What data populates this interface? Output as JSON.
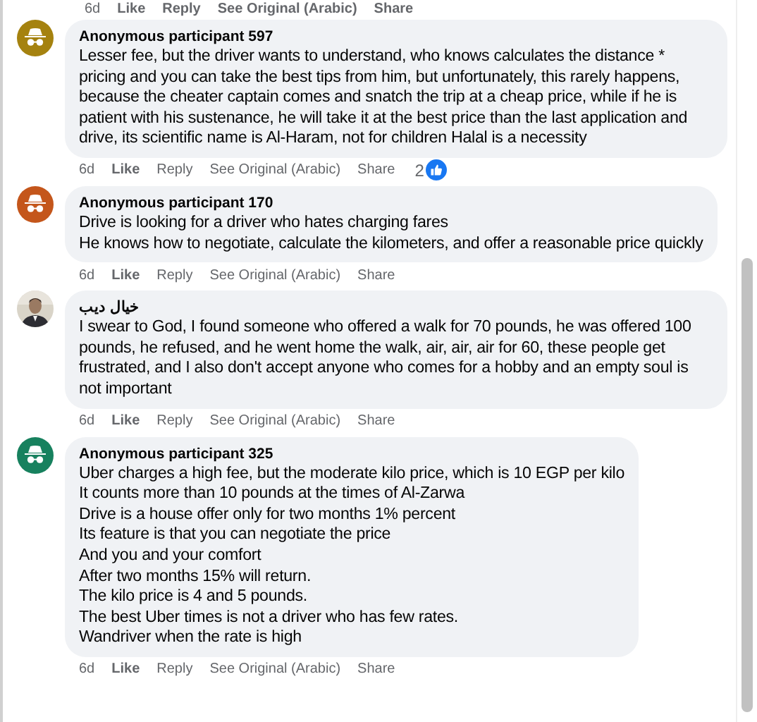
{
  "top_actions": {
    "time": "6d",
    "like": "Like",
    "reply": "Reply",
    "see_original": "See Original (Arabic)",
    "share": "Share"
  },
  "comments": [
    {
      "avatar": {
        "kind": "anonymous",
        "color": "#a5820f"
      },
      "name": "Anonymous participant 597",
      "paragraphs": [
        "Lesser fee, but the driver wants to understand, who knows calculates the distance * pricing and you can take the best tips from him, but unfortunately, this rarely happens, because the cheater captain comes and snatch the trip at a cheap price, while if he is patient with his sustenance, he will take it at the best price than the last application and drive, its scientific name is Al-Haram, not for children Halal is a necessity"
      ],
      "time": "6d",
      "like": "Like",
      "reply": "Reply",
      "see_original": "See Original (Arabic)",
      "share": "Share",
      "reactions": "2"
    },
    {
      "avatar": {
        "kind": "anonymous",
        "color": "#c4561b"
      },
      "name": "Anonymous participant 170",
      "paragraphs": [
        "Drive is looking for a driver who hates charging fares",
        "He knows how to negotiate, calculate the kilometers, and offer a reasonable price quickly"
      ],
      "time": "6d",
      "like": "Like",
      "reply": "Reply",
      "see_original": "See Original (Arabic)",
      "share": "Share"
    },
    {
      "avatar": {
        "kind": "picture"
      },
      "name": "خيال ديب",
      "paragraphs": [
        "I swear to God, I found someone who offered a walk for 70 pounds, he was offered 100 pounds, he refused, and he went home the walk, air, air, air for 60, these people get frustrated, and I also don't accept anyone who comes for a hobby and an empty soul is not important"
      ],
      "time": "6d",
      "like": "Like",
      "reply": "Reply",
      "see_original": "See Original (Arabic)",
      "share": "Share"
    },
    {
      "avatar": {
        "kind": "anonymous",
        "color": "#17815e"
      },
      "name": "Anonymous participant 325",
      "paragraphs": [
        "Uber charges a high fee, but the moderate kilo price, which is 10 EGP per kilo",
        "It counts more than 10 pounds at the times of Al-Zarwa",
        "Drive is a house offer only for two months 1% percent",
        "Its feature is that you can negotiate the price",
        "And you and your comfort",
        "After two months 15% will return.",
        "The kilo price is 4 and 5 pounds.",
        "The best Uber times is not a driver who has few rates.",
        "Wandriver when the rate is high"
      ],
      "time": "6d",
      "like": "Like",
      "reply": "Reply",
      "see_original": "See Original (Arabic)",
      "share": "Share"
    }
  ]
}
